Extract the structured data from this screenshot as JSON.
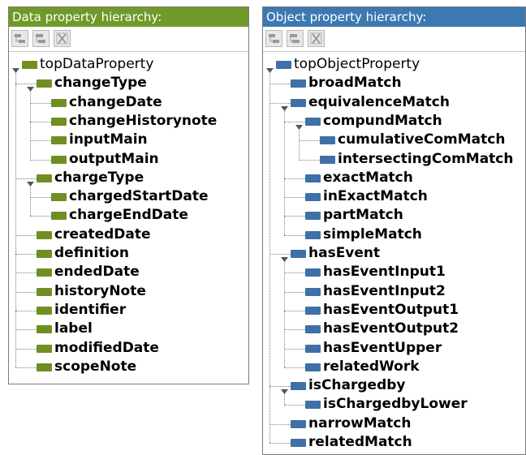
{
  "colors": {
    "data_header": "#6f9a29",
    "data_icon": "#6f8f22",
    "object_header": "#3c79b1",
    "object_icon": "#3f70a7"
  },
  "data_panel": {
    "title": "Data property hierarchy:",
    "toolbar": [
      {
        "name": "add-subproperty-icon"
      },
      {
        "name": "add-sibling-property-icon"
      },
      {
        "name": "delete-property-icon"
      }
    ],
    "tree": [
      {
        "label": "topDataProperty",
        "depth": 0,
        "expanded": true,
        "root": true
      },
      {
        "label": "changeType",
        "depth": 1,
        "expanded": true
      },
      {
        "label": "changeDate",
        "depth": 2
      },
      {
        "label": "changeHistorynote",
        "depth": 2
      },
      {
        "label": "inputMain",
        "depth": 2
      },
      {
        "label": "outputMain",
        "depth": 2
      },
      {
        "label": "chargeType",
        "depth": 1,
        "expanded": true
      },
      {
        "label": "chargedStartDate",
        "depth": 2
      },
      {
        "label": "chargeEndDate",
        "depth": 2
      },
      {
        "label": "createdDate",
        "depth": 1
      },
      {
        "label": "definition",
        "depth": 1
      },
      {
        "label": "endedDate",
        "depth": 1
      },
      {
        "label": "historyNote",
        "depth": 1
      },
      {
        "label": "identifier",
        "depth": 1
      },
      {
        "label": "label",
        "depth": 1
      },
      {
        "label": "modifiedDate",
        "depth": 1
      },
      {
        "label": "scopeNote",
        "depth": 1
      }
    ]
  },
  "object_panel": {
    "title": "Object property hierarchy:",
    "toolbar": [
      {
        "name": "add-subproperty-icon"
      },
      {
        "name": "add-sibling-property-icon"
      },
      {
        "name": "delete-property-icon"
      }
    ],
    "tree": [
      {
        "label": "topObjectProperty",
        "depth": 0,
        "expanded": true,
        "root": true
      },
      {
        "label": "broadMatch",
        "depth": 1
      },
      {
        "label": "equivalenceMatch",
        "depth": 1,
        "expanded": true
      },
      {
        "label": "compundMatch",
        "depth": 2,
        "expanded": true
      },
      {
        "label": "cumulativeComMatch",
        "depth": 3
      },
      {
        "label": "intersectingComMatch",
        "depth": 3
      },
      {
        "label": "exactMatch",
        "depth": 2
      },
      {
        "label": "inExactMatch",
        "depth": 2
      },
      {
        "label": "partMatch",
        "depth": 2
      },
      {
        "label": "simpleMatch",
        "depth": 2
      },
      {
        "label": "hasEvent",
        "depth": 1,
        "expanded": true
      },
      {
        "label": "hasEventInput1",
        "depth": 2
      },
      {
        "label": "hasEventInput2",
        "depth": 2
      },
      {
        "label": "hasEventOutput1",
        "depth": 2
      },
      {
        "label": "hasEventOutput2",
        "depth": 2
      },
      {
        "label": "hasEventUpper",
        "depth": 2
      },
      {
        "label": "relatedWork",
        "depth": 2
      },
      {
        "label": "isChargedby",
        "depth": 1,
        "expanded": true
      },
      {
        "label": "isChargedbyLower",
        "depth": 2
      },
      {
        "label": "narrowMatch",
        "depth": 1
      },
      {
        "label": "relatedMatch",
        "depth": 1
      }
    ]
  }
}
